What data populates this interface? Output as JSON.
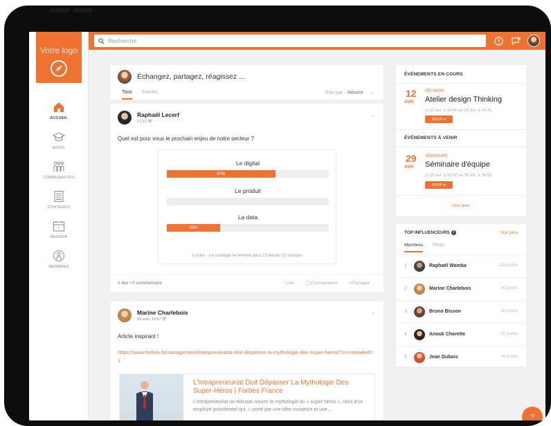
{
  "sidebar": {
    "logo_text": "Votre logo",
    "items": [
      {
        "label": "ACCUEIL",
        "icon": "home-icon"
      },
      {
        "label": "MOOC",
        "icon": "graduation-cap-icon"
      },
      {
        "label": "COMMUNAUTÉS",
        "icon": "community-icon"
      },
      {
        "label": "CONTENUS",
        "icon": "document-icon"
      },
      {
        "label": "AGENDA",
        "icon": "calendar-icon"
      },
      {
        "label": "MEMBRES",
        "icon": "member-icon"
      }
    ]
  },
  "topbar": {
    "search_placeholder": "Recherche"
  },
  "colors": {
    "accent": "#ee7333"
  },
  "composer": {
    "prompt": "Échangez, partagez, réagissez ...",
    "tabs": [
      "Tous",
      "Suivies"
    ],
    "sort_label": "Trier par :",
    "sort_value": "Récent"
  },
  "post1": {
    "author": "Raphaël Lecerf",
    "time": "17:22",
    "question": "Quel est pour vous le prochain enjeu de notre secteur ?",
    "poll": [
      {
        "label": "Le digital",
        "percent": 67,
        "percent_label": "67%"
      },
      {
        "label": "Le produit",
        "percent": 0,
        "percent_label": ""
      },
      {
        "label": "La data",
        "percent": 33,
        "percent_label": "33%"
      }
    ],
    "poll_footer": "3 votes · Le sondage se termine dans 23 heures 52 minutes",
    "likes": "0 like • 0 commentaire",
    "actions": [
      "Like",
      "Commentaire",
      "Partager"
    ]
  },
  "post2": {
    "author": "Marine Charlebois",
    "time": "09 avril, 14:57",
    "text": "Article inspirant !",
    "link": "https://www.forbes.fr/management/lintrapreneuriat-doit-depasser-la-mythologie-des-super-heros/?cn-reloaded=1",
    "link_title": "L'Intrapreneuriat Doit Dépasser La Mythologie Des Super-Héros  | Forbes France",
    "link_desc": "L'intrapreneuriat ne doit pas nourrir la mythologie du « super héros », celui d'un employé providentiel qui, « porté par une idée novatrice et une..."
  },
  "events": {
    "current_title": "ÉVÉNEMENTS EN COURS",
    "current": {
      "day": "12",
      "month": "AVR.",
      "type": "RÉUNION",
      "title": "Atelier design Thinking",
      "time": "10 avr. à 14:40 au 20 avr. à 14:41",
      "rsvp": "RSVP"
    },
    "upcoming_title": "ÉVÉNEMENTS À VENIR",
    "upcoming": {
      "day": "29",
      "month": "AVR.",
      "type": "SÉMINAIRE",
      "title": "Séminaire d'équipe",
      "time": "29 avr. à 16:52 au 30 avr. à 16:53",
      "rsvp": "RSVP"
    },
    "more": "Voir plus"
  },
  "influencers": {
    "title": "TOP INFLUENCEURS",
    "more": "Voir plus",
    "tabs": [
      "Membres",
      "Filiale"
    ],
    "rows": [
      {
        "rank": "1",
        "name": "Raphaël Wamba",
        "points": "338 points"
      },
      {
        "rank": "2",
        "name": "Marine Charlebois",
        "points": "90 points"
      },
      {
        "rank": "3",
        "name": "Bruno Bisson",
        "points": "56 points"
      },
      {
        "rank": "4",
        "name": "Anouk Charette",
        "points": "50 points"
      },
      {
        "rank": "5",
        "name": "Jean Dubois",
        "points": "44 points"
      }
    ]
  },
  "help": {
    "label": "?"
  }
}
